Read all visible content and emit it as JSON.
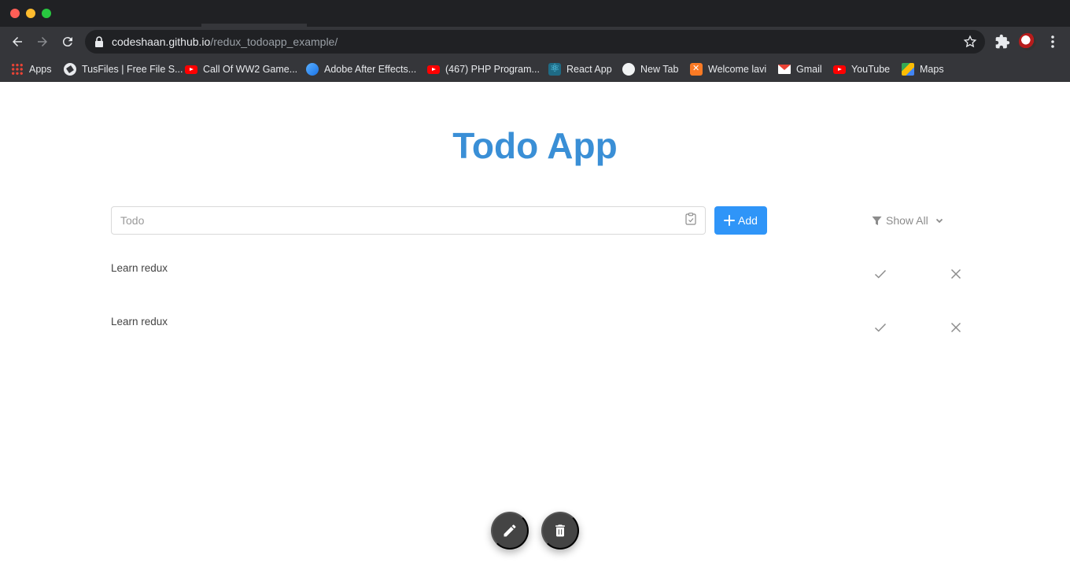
{
  "browser": {
    "url_host": "codeshaan.github.io",
    "url_path": "/redux_todoapp_example/",
    "bookmarks": [
      {
        "label": "Apps",
        "icon": "apps-icon"
      },
      {
        "label": "TusFiles | Free File S...",
        "icon": "globe-icon"
      },
      {
        "label": "Call Of WW2 Game...",
        "icon": "youtube-icon"
      },
      {
        "label": "Adobe After Effects...",
        "icon": "after-effects-icon"
      },
      {
        "label": "(467) PHP Program...",
        "icon": "youtube-icon"
      },
      {
        "label": "React App",
        "icon": "react-icon"
      },
      {
        "label": "New Tab",
        "icon": "new-tab-icon"
      },
      {
        "label": "Welcome lavi",
        "icon": "xampp-icon"
      },
      {
        "label": "Gmail",
        "icon": "gmail-icon"
      },
      {
        "label": "YouTube",
        "icon": "youtube-icon"
      },
      {
        "label": "Maps",
        "icon": "maps-icon"
      }
    ]
  },
  "app": {
    "title": "Todo App",
    "input_placeholder": "Todo",
    "input_value": "",
    "add_label": "Add",
    "filter_label": "Show All",
    "todos": [
      {
        "text": "Learn redux"
      },
      {
        "text": "Learn redux"
      }
    ]
  },
  "colors": {
    "title": "#3a8fd6",
    "primary_button": "#2f95f8",
    "fab": "#444444"
  }
}
